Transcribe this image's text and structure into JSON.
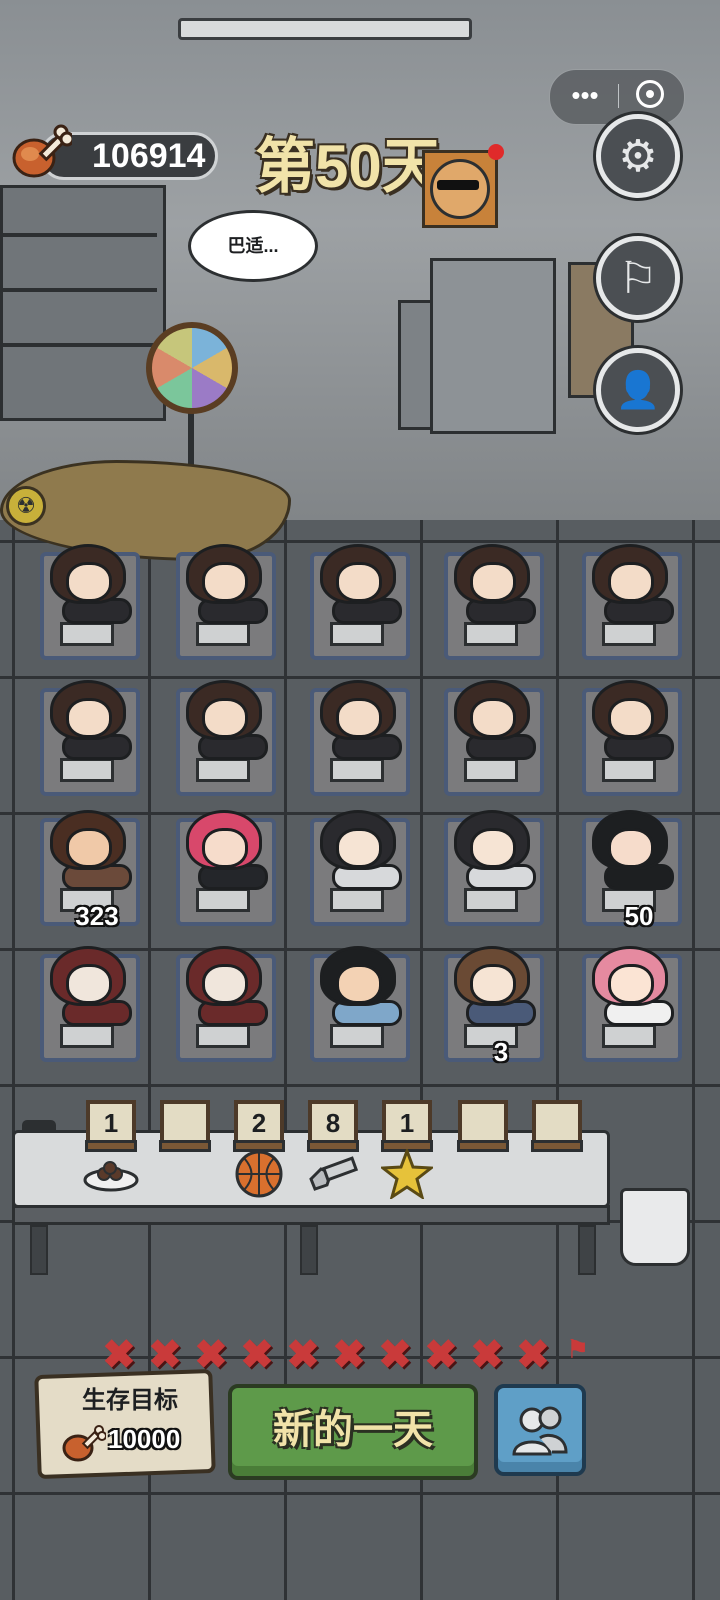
{
  "hud": {
    "meat_count": "106914",
    "day_title": "第50天",
    "speech_bubble": "巴适..."
  },
  "mini_program_capsule": {
    "more_glyph": "•••",
    "close_icon": "target-icon"
  },
  "side_buttons": [
    {
      "name": "settings-button",
      "icon": "gear-icon",
      "glyph": "⚙"
    },
    {
      "name": "flag-button",
      "icon": "flag-icon",
      "glyph": "⚐"
    },
    {
      "name": "user-search-button",
      "icon": "user-search-icon",
      "glyph": "👤"
    }
  ],
  "grid": {
    "rows": [
      [
        {
          "character": "ponytail-girl",
          "label": ""
        },
        {
          "character": "ponytail-girl",
          "label": ""
        },
        {
          "character": "ponytail-girl",
          "label": ""
        },
        {
          "character": "ponytail-girl",
          "label": ""
        },
        {
          "character": "ponytail-girl",
          "label": ""
        }
      ],
      [
        {
          "character": "ponytail-girl",
          "label": ""
        },
        {
          "character": "ponytail-girl",
          "label": ""
        },
        {
          "character": "ponytail-girl",
          "label": ""
        },
        {
          "character": "ponytail-girl",
          "label": ""
        },
        {
          "character": "ponytail-girl",
          "label": ""
        }
      ],
      [
        {
          "character": "headband-boy",
          "label": "323"
        },
        {
          "character": "pink-hair-girl",
          "label": ""
        },
        {
          "character": "long-hair-girl",
          "label": ""
        },
        {
          "character": "long-hair-girl",
          "label": ""
        },
        {
          "character": "uniform-boy",
          "label": "50"
        }
      ],
      [
        {
          "character": "hooded-glasses-girl",
          "label": ""
        },
        {
          "character": "hooded-glasses-girl",
          "label": ""
        },
        {
          "character": "basketball-boy",
          "label": ""
        },
        {
          "character": "brown-hair-girl",
          "label": "3"
        },
        {
          "character": "pink-pigtail-girl",
          "label": ""
        }
      ]
    ]
  },
  "inventory": [
    {
      "count": "1",
      "item": "chocolate-plate-icon"
    },
    {
      "count": "",
      "item": ""
    },
    {
      "count": "2",
      "item": "basketball-icon"
    },
    {
      "count": "8",
      "item": "bolt-icon"
    },
    {
      "count": "1",
      "item": "gold-star-icon"
    },
    {
      "count": "",
      "item": ""
    },
    {
      "count": "",
      "item": ""
    }
  ],
  "failed_days_marks": [
    "✖",
    "✖",
    "✖",
    "✖",
    "✖",
    "✖",
    "✖",
    "✖",
    "✖",
    "✖"
  ],
  "goal": {
    "title": "生存目标",
    "value": "10000"
  },
  "new_day_button": "新的一天",
  "colors": {
    "accent_green": "#5e9a4a",
    "accent_blue": "#5f9fc7",
    "title_cream": "#f1e3a9",
    "cross_red": "#c93a3a"
  }
}
